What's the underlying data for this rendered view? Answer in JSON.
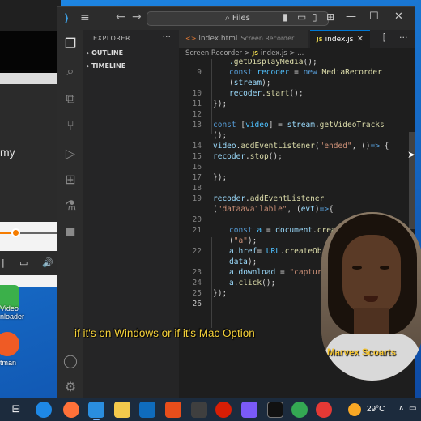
{
  "background_window": {
    "partial_text": "my",
    "progress_fraction": 0.25
  },
  "desktop": {
    "icons": [
      {
        "name": "video-downloader-icon",
        "label_line1": "Video",
        "label_line2": "nloader"
      },
      {
        "name": "postman-icon",
        "label": "tman"
      }
    ]
  },
  "vscode": {
    "search_label": "Files",
    "explorer_title": "EXPLORER",
    "outline_label": "OUTLINE",
    "timeline_label": "TIMELINE",
    "tabs": [
      {
        "label": "index.html",
        "subtitle": "Screen Recorder",
        "icon": "html-icon",
        "active": false
      },
      {
        "label": "index.js",
        "icon": "js-icon",
        "active": true
      }
    ],
    "breadcrumb": {
      "folder": "Screen Recorder",
      "sep": ">",
      "file": "index.js",
      "tail": "> ..."
    },
    "line_numbers": [
      "",
      "9",
      "",
      "10",
      "11",
      "12",
      "13",
      "",
      "14",
      "15",
      "16",
      "17",
      "18",
      "19",
      "",
      "20",
      "21",
      "",
      "22",
      "",
      "23",
      "24",
      "25",
      "26"
    ]
  },
  "caption": "if it's on Windows or if it's Mac Option",
  "webcam_name": "Marvex Scoarts",
  "taskbar": {
    "temperature": "29°C",
    "colors": {
      "accent": "#0078d4",
      "caption": "#f6d23a",
      "name": "#f4c430"
    }
  }
}
